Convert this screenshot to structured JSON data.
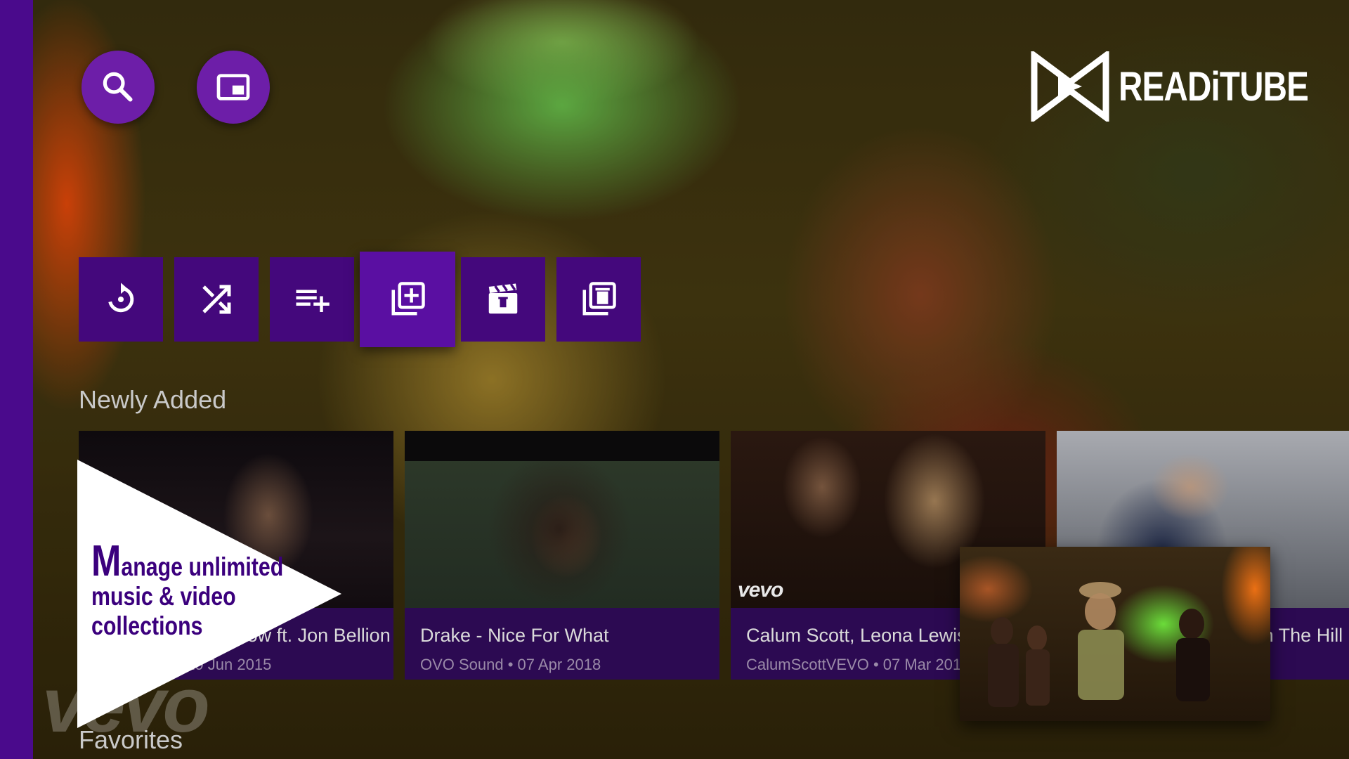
{
  "app": {
    "name": "READiTUBE"
  },
  "top_buttons": {
    "search_icon": "search-icon",
    "pip_icon": "picture-in-picture-icon"
  },
  "actions": [
    {
      "icon": "refresh-icon"
    },
    {
      "icon": "shuffle-icon"
    },
    {
      "icon": "playlist-add-icon"
    },
    {
      "icon": "library-add-icon",
      "focused": true
    },
    {
      "icon": "video-library-icon"
    },
    {
      "icon": "delete-collection-icon"
    }
  ],
  "sections": {
    "newly_added": "Newly Added",
    "favorites": "Favorites"
  },
  "cards": [
    {
      "title": "Zedd - Beautiful Now ft. Jon Bellion",
      "meta": "ZeddVEVO • 19 Jun 2015"
    },
    {
      "title": "Drake - Nice For What",
      "meta": "OVO Sound • 07 Apr 2018"
    },
    {
      "title": "Calum Scott, Leona Lewis - You Are The Reason",
      "meta": "CalumScottVEVO • 07 Mar 2018",
      "badge": "vevo"
    },
    {
      "title": "Ed Sheeran - Castle On The Hill [Official Video]",
      "meta": ""
    }
  ],
  "promo": {
    "first_letter": "M",
    "line1_rest": "anage unlimited",
    "line2": "music & video",
    "line3": "collections"
  },
  "ghost_badge": "vevo",
  "colors": {
    "accent": "#6d1ea8",
    "strip": "#4a0a8c",
    "tile": "#44087c",
    "card_info": "#2c0a52"
  }
}
